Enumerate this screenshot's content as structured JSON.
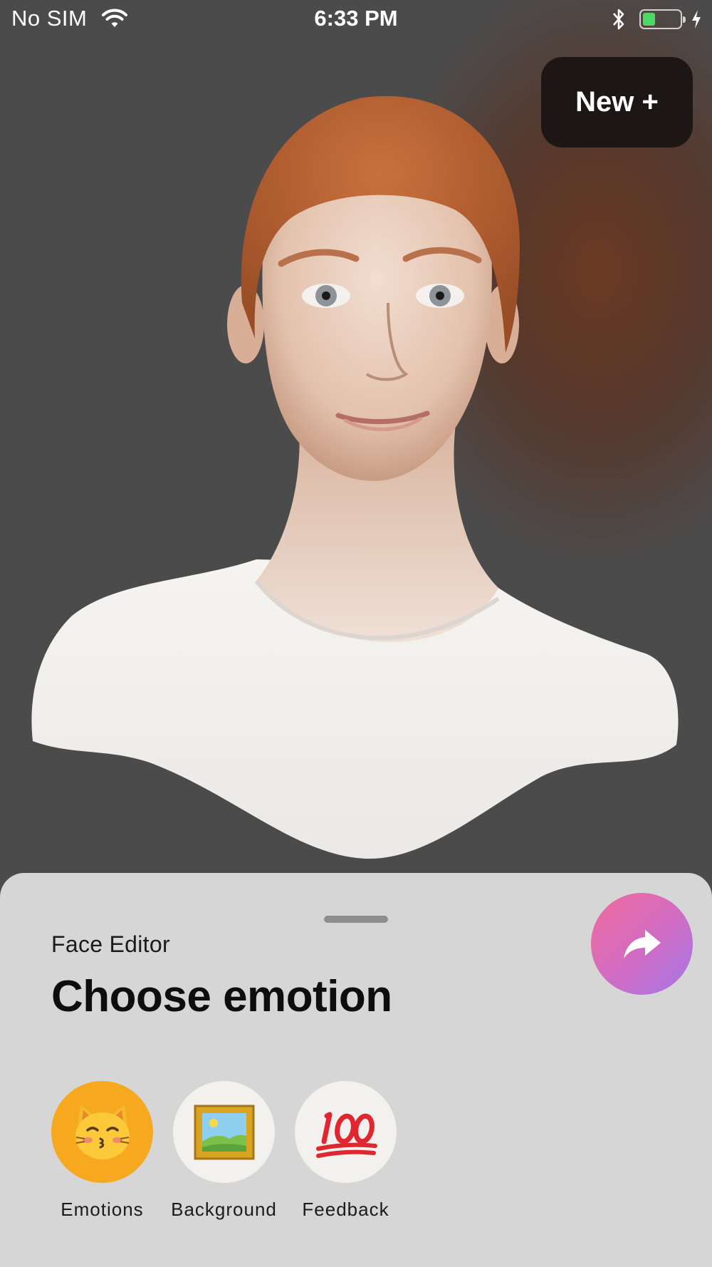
{
  "status_bar": {
    "carrier": "No SIM",
    "time": "6:33 PM",
    "battery_level": 0.35,
    "icons": [
      "wifi-icon",
      "bluetooth-icon",
      "battery-icon",
      "charging-bolt-icon"
    ]
  },
  "header": {
    "new_button_label": "New +"
  },
  "sheet": {
    "subtitle": "Face Editor",
    "title": "Choose emotion",
    "share_icon": "share-arrow-icon",
    "share_gradient": [
      "#f06b9b",
      "#a377e8"
    ],
    "tools": [
      {
        "label": "Emotions",
        "icon": "kissing-cat-emoji-icon",
        "selected": true
      },
      {
        "label": "Background",
        "icon": "framed-picture-emoji-icon",
        "selected": false
      },
      {
        "label": "Feedback",
        "icon": "hundred-points-emoji-icon",
        "selected": false
      }
    ]
  },
  "colors": {
    "background": "#4d4d4d",
    "sheet": "#d6d6d6",
    "selected_tool": "#f6a81e",
    "battery_fill": "#4cd964"
  }
}
